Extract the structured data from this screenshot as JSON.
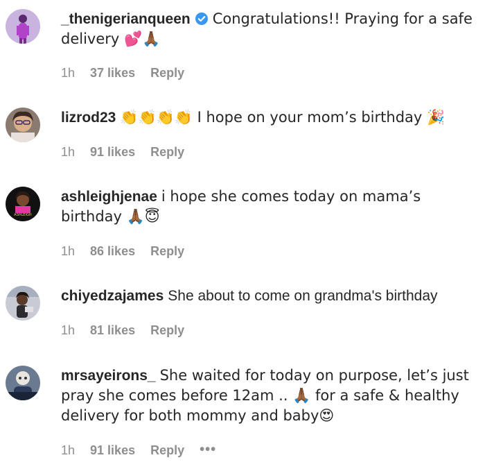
{
  "comments": [
    {
      "username": "_thenigerianqueen",
      "verified": true,
      "text": "Congratulations!! Praying for a safe delivery 💕🙏🏾",
      "time": "1h",
      "likes": "37 likes",
      "reply": "Reply"
    },
    {
      "username": "lizrod23",
      "verified": false,
      "text": "👏👏👏👏 I hope on your mom’s birthday 🎉",
      "time": "1h",
      "likes": "91 likes",
      "reply": "Reply"
    },
    {
      "username": "ashleighjenae",
      "verified": false,
      "text": "i hope she comes today on mama’s birthday 🙏🏾😇",
      "time": "1h",
      "likes": "86 likes",
      "reply": "Reply"
    },
    {
      "username": "chiyedzajames",
      "verified": false,
      "text": "She about to come on grandma's birthday",
      "time": "1h",
      "likes": "81 likes",
      "reply": "Reply"
    },
    {
      "username": "mrsayeirons_",
      "verified": false,
      "text": "She waited for today on purpose, let’s just pray she comes before 12am .. 🙏🏾 for a safe & healthy delivery for both mommy and baby😍",
      "time": "1h",
      "likes": "91 likes",
      "reply": "Reply",
      "more": "•••"
    }
  ],
  "colors": {
    "text": "#262626",
    "meta": "#8e8e8e",
    "verified": "#3897f0"
  }
}
